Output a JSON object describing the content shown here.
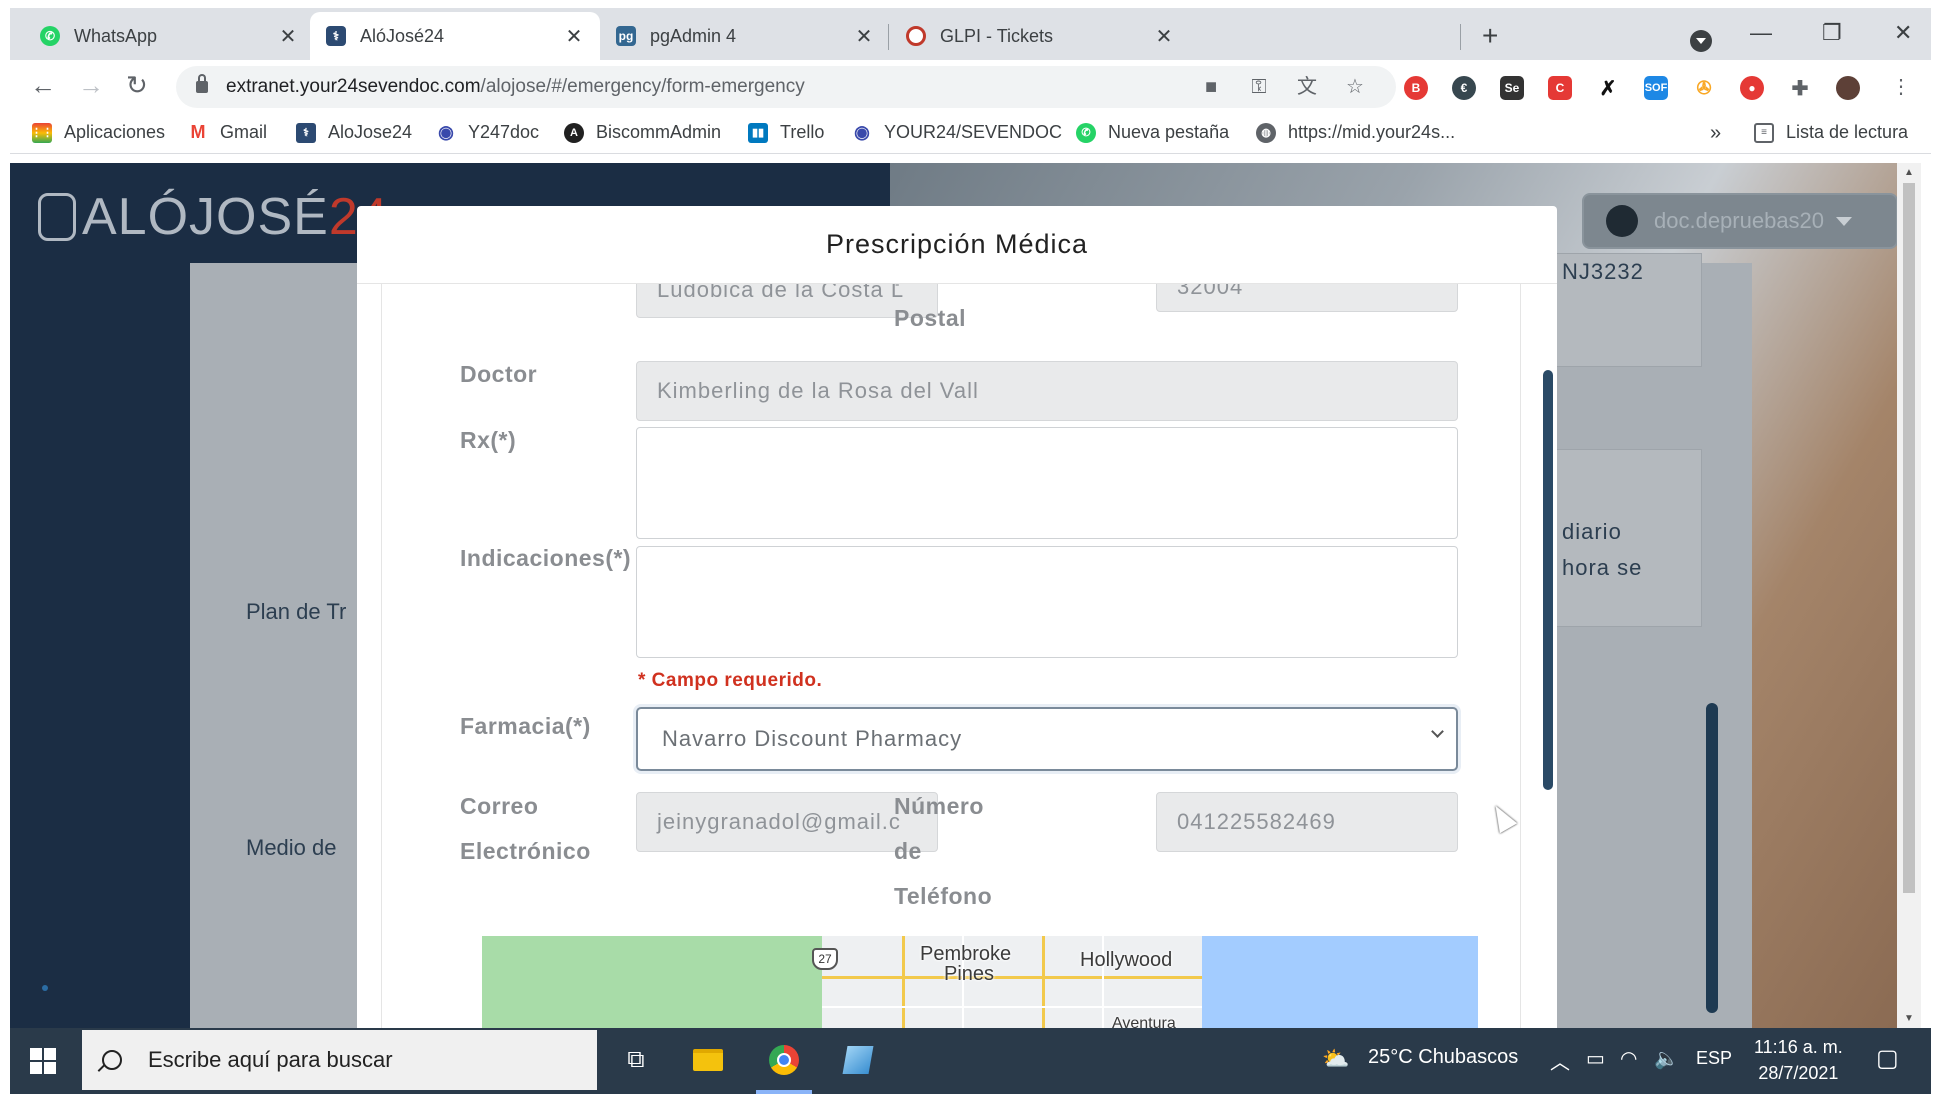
{
  "browser": {
    "tabs": [
      {
        "label": "WhatsApp",
        "icon": "whatsapp-icon",
        "color": "#25d366"
      },
      {
        "label": "AlóJosé24",
        "icon": "alojose-icon",
        "color": "#2c4a72"
      },
      {
        "label": "pgAdmin 4",
        "icon": "pgadmin-icon",
        "color": "#336791"
      },
      {
        "label": "GLPI - Tickets",
        "icon": "glpi-icon",
        "color": "#c0392b"
      }
    ],
    "url_host": "extranet.your24sevendoc.com",
    "url_path": "/alojose/#/emergency/form-emergency",
    "bookmarks": [
      {
        "label": "Aplicaciones",
        "icon": "apps-grid-icon"
      },
      {
        "label": "Gmail",
        "icon": "gmail-icon"
      },
      {
        "label": "AloJose24",
        "icon": "alojose-icon"
      },
      {
        "label": "Y247doc",
        "icon": "y247doc-icon"
      },
      {
        "label": "BiscommAdmin",
        "icon": "angular-icon"
      },
      {
        "label": "Trello",
        "icon": "trello-icon"
      },
      {
        "label": "YOUR24/SEVENDOC",
        "icon": "y247doc-icon"
      },
      {
        "label": "Nueva pestaña",
        "icon": "whatsapp-icon"
      },
      {
        "label": "https://mid.your24s...",
        "icon": "globe-icon"
      }
    ],
    "overflow": "»",
    "reading_list": "Lista de lectura"
  },
  "app": {
    "logo_main": "ALÓJOSÉ",
    "logo_num": "24",
    "user": "doc.depruebas20",
    "bg_labels": [
      "Plan de Tr",
      "Medio de"
    ],
    "bg_snippets": [
      "NJ3232",
      "diario",
      "hora se"
    ]
  },
  "modal": {
    "title": "Prescripción Médica",
    "fields": {
      "top_left_value": "Ludobica de la Costa L",
      "postal_label": "Postal",
      "postal_value": "32004",
      "doctor_label": "Doctor",
      "doctor_value": "Kimberling de la Rosa del Vall",
      "rx_label": "Rx(*)",
      "indicaciones_label": "Indicaciones(*)",
      "required_msg": "* Campo requerido.",
      "farmacia_label": "Farmacia(*)",
      "farmacia_value": "Navarro Discount Pharmacy",
      "correo_label_1": "Correo",
      "correo_label_2": "Electrónico",
      "correo_value": "jeinygranadol@gmail.c",
      "telefono_label_1": "Número",
      "telefono_label_2": "de",
      "telefono_label_3": "Teléfono",
      "telefono_value": "041225582469"
    },
    "map": {
      "labels": [
        "Pembroke",
        "Pines",
        "Hollywood",
        "Aventura"
      ],
      "shield": "27"
    }
  },
  "taskbar": {
    "search_placeholder": "Escribe aquí para buscar",
    "weather": "25°C  Chubascos",
    "lang": "ESP",
    "time": "11:16 a. m.",
    "date": "28/7/2021"
  }
}
